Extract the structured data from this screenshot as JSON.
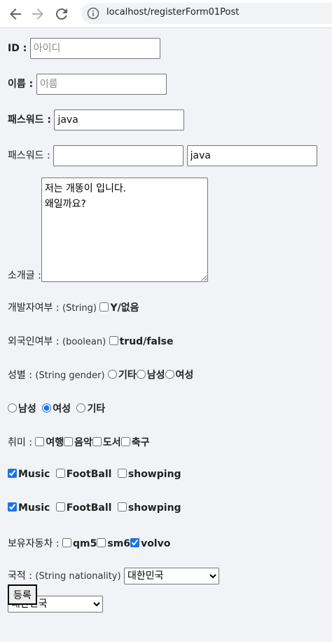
{
  "browser": {
    "url": "localhost/registerForm01Post"
  },
  "form": {
    "id_label": "ID :",
    "id_placeholder": "아이디",
    "name_label": "이름 :",
    "name_placeholder": "이름",
    "password_label": "패스워드 :",
    "password_value": "java",
    "password2_label": "패스워드 :",
    "password2_value": "",
    "password3_value": "java",
    "intro_label": "소개글 :",
    "intro_value": "저는 개똥이 입니다.\n왜일까요?",
    "developer_label": "개발자여부 :",
    "developer_type": "(String)",
    "developer_option": "Y/없음",
    "foreigner_label": "외국인여부 :",
    "foreigner_type": "(boolean)",
    "foreigner_option": "trud/false",
    "gender_label": "성별 :",
    "gender_type": "(String gender)",
    "gender_options": [
      "기타",
      "남성",
      "여성"
    ],
    "gender2_options": [
      "남성",
      "여성",
      "기타"
    ],
    "gender2_selected": "여성",
    "hobby_label": "취미 :",
    "hobby_options": [
      "여행",
      "음악",
      "도서",
      "축구"
    ],
    "sports1": [
      {
        "label": "Music",
        "checked": true
      },
      {
        "label": "FootBall",
        "checked": false
      },
      {
        "label": "showping",
        "checked": false
      }
    ],
    "sports2": [
      {
        "label": "Music",
        "checked": true
      },
      {
        "label": "FootBall",
        "checked": false
      },
      {
        "label": "showping",
        "checked": false
      }
    ],
    "car_label": "보유자동차 :",
    "car_options": [
      {
        "label": "qm5",
        "checked": false
      },
      {
        "label": "sm6",
        "checked": false
      },
      {
        "label": "volvo",
        "checked": true
      }
    ],
    "nationality_label": "국적 :",
    "nationality_type": "(String nationality)",
    "nationality_value": "대한민국",
    "nationality2_value": "대한민국",
    "submit_label": "등록"
  }
}
